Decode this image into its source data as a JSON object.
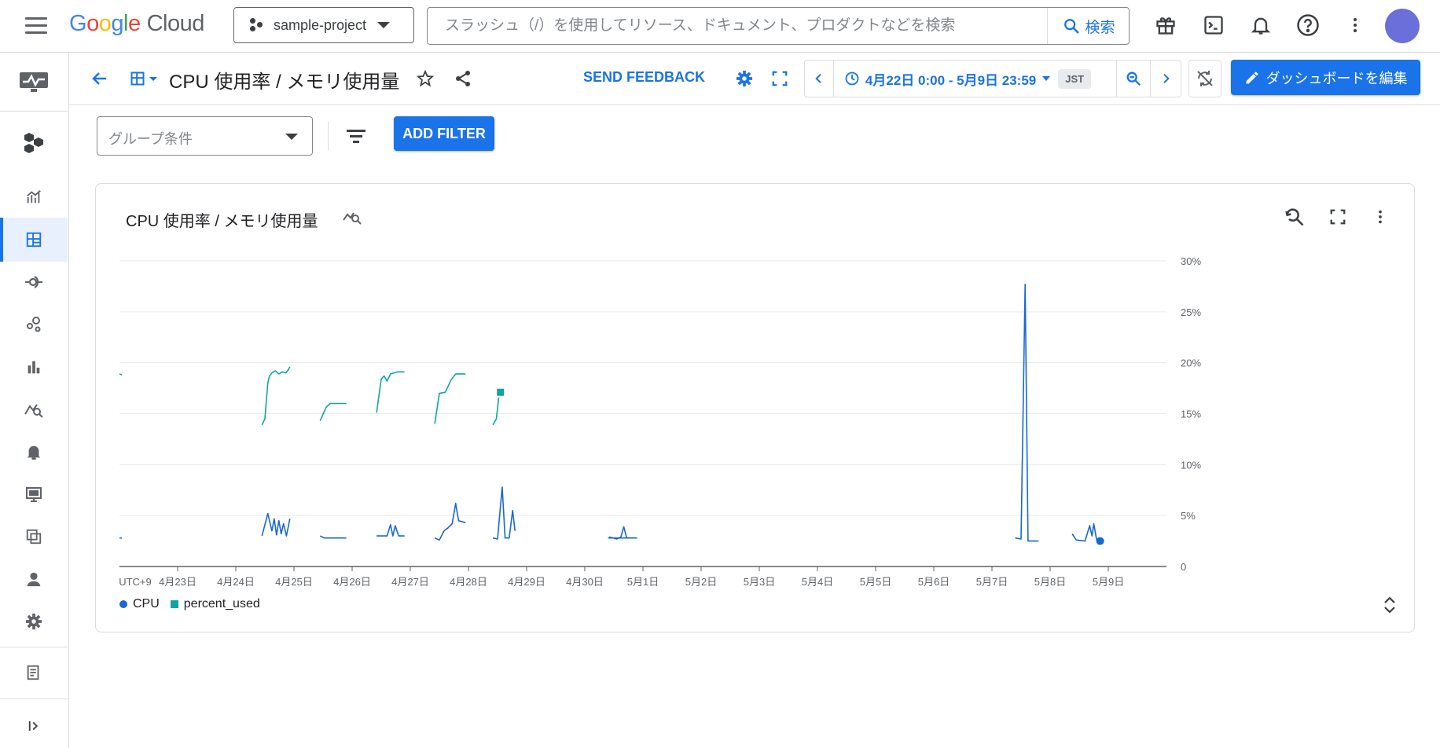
{
  "header": {
    "logo_google": "Google",
    "logo_cloud": "Cloud",
    "project": "sample-project",
    "search_placeholder": "スラッシュ（/）を使用してリソース、ドキュメント、プロダクトなどを検索",
    "search_button": "検索",
    "icons": [
      "gift-icon",
      "terminal-icon",
      "bell-icon",
      "help-icon",
      "more-vert-icon"
    ],
    "avatar_color": "#6b6fd9"
  },
  "sidebar": {
    "items": [
      "monitoring-logo-icon",
      "hexagons-icon",
      "metrics-explorer-icon",
      "dashboards-icon",
      "services-icon",
      "integrations-icon",
      "bar-chart-icon",
      "query-icon",
      "alerting-icon",
      "monitor-icon",
      "groups-icon",
      "person-icon",
      "settings-icon",
      "release-notes-icon",
      "collapse-icon"
    ],
    "active_item": "dashboards-icon"
  },
  "toolbar": {
    "title": "CPU 使用率 / メモリ使用量",
    "send_feedback": "SEND FEEDBACK",
    "time_range": "4月22日 0:00 - 5月9日 23:59",
    "timezone": "JST",
    "edit_dashboard": "ダッシュボードを編集"
  },
  "filters": {
    "group_placeholder": "グループ条件",
    "add_filter": "ADD FILTER"
  },
  "chart_card": {
    "title": "CPU 使用率 / メモリ使用量"
  },
  "colors": {
    "accent": "#1a73e8",
    "cpu_series": "#1967d2",
    "memory_series": "#12a4a0"
  },
  "chart_data": {
    "type": "line",
    "x_tick_labels": [
      "UTC+9",
      "4月23日",
      "4月24日",
      "4月25日",
      "4月26日",
      "4月27日",
      "4月28日",
      "4月29日",
      "4月30日",
      "5月1日",
      "5月2日",
      "5月3日",
      "5月4日",
      "5月5日",
      "5月6日",
      "5月7日",
      "5月8日",
      "5月9日"
    ],
    "y_tick_labels": [
      "30%",
      "25%",
      "20%",
      "15%",
      "10%",
      "5%",
      "0"
    ],
    "ylim": [
      0,
      30
    ],
    "xlim_days": [
      22.0,
      40.0
    ],
    "grid": true,
    "legend_position": "bottom-left",
    "series": [
      {
        "name": "CPU",
        "marker": "circle",
        "color": "#1967d2",
        "segments": [
          [
            [
              22.0,
              2.8
            ],
            [
              22.04,
              2.8
            ]
          ],
          [
            [
              24.45,
              3.0
            ],
            [
              24.55,
              5.2
            ],
            [
              24.62,
              3.5
            ],
            [
              24.66,
              4.7
            ],
            [
              24.7,
              3.1
            ],
            [
              24.74,
              4.5
            ],
            [
              24.78,
              3.2
            ],
            [
              24.82,
              4.2
            ],
            [
              24.87,
              3.0
            ],
            [
              24.93,
              4.7
            ]
          ],
          [
            [
              25.45,
              3.0
            ],
            [
              25.52,
              2.8
            ],
            [
              25.9,
              2.8
            ]
          ],
          [
            [
              26.42,
              3.0
            ],
            [
              26.6,
              3.0
            ],
            [
              26.66,
              4.1
            ],
            [
              26.7,
              3.0
            ],
            [
              26.74,
              4.0
            ],
            [
              26.8,
              3.0
            ],
            [
              26.9,
              3.0
            ]
          ],
          [
            [
              27.42,
              2.8
            ],
            [
              27.5,
              2.6
            ],
            [
              27.58,
              3.5
            ],
            [
              27.65,
              3.8
            ],
            [
              27.72,
              4.2
            ],
            [
              27.78,
              6.2
            ],
            [
              27.83,
              4.5
            ],
            [
              27.95,
              4.3
            ]
          ],
          [
            [
              28.42,
              2.8
            ],
            [
              28.5,
              2.7
            ],
            [
              28.58,
              7.8
            ],
            [
              28.63,
              2.8
            ],
            [
              28.7,
              2.8
            ],
            [
              28.76,
              5.5
            ],
            [
              28.8,
              3.5
            ]
          ],
          [
            [
              30.4,
              2.8
            ],
            [
              30.85,
              2.8
            ]
          ],
          [
            [
              30.42,
              2.9
            ],
            [
              30.55,
              2.7
            ],
            [
              30.62,
              2.9
            ],
            [
              30.67,
              3.9
            ],
            [
              30.72,
              2.8
            ],
            [
              30.9,
              2.8
            ]
          ],
          [
            [
              37.4,
              2.8
            ],
            [
              37.5,
              2.7
            ],
            [
              37.57,
              27.7
            ],
            [
              37.62,
              2.5
            ],
            [
              37.8,
              2.5
            ]
          ],
          [
            [
              38.38,
              3.2
            ],
            [
              38.45,
              2.6
            ],
            [
              38.6,
              2.5
            ],
            [
              38.68,
              4.0
            ],
            [
              38.72,
              3.0
            ],
            [
              38.75,
              4.2
            ],
            [
              38.8,
              2.6
            ],
            [
              38.86,
              2.5
            ]
          ]
        ],
        "last_point": [
          38.86,
          2.5
        ]
      },
      {
        "name": "percent_used",
        "marker": "square",
        "color": "#12a4a0",
        "segments": [
          [
            [
              22.0,
              18.9
            ],
            [
              22.04,
              18.8
            ]
          ],
          [
            [
              24.45,
              13.9
            ],
            [
              24.5,
              14.5
            ],
            [
              24.55,
              18.0
            ],
            [
              24.58,
              18.7
            ],
            [
              24.62,
              19.0
            ],
            [
              24.68,
              19.2
            ],
            [
              24.74,
              18.9
            ],
            [
              24.8,
              19.1
            ],
            [
              24.86,
              19.0
            ],
            [
              24.9,
              19.3
            ],
            [
              24.93,
              19.6
            ]
          ],
          [
            [
              25.45,
              14.3
            ],
            [
              25.55,
              15.6
            ],
            [
              25.62,
              16.0
            ],
            [
              25.9,
              16.0
            ]
          ],
          [
            [
              26.42,
              15.1
            ],
            [
              26.5,
              18.4
            ],
            [
              26.55,
              18.7
            ],
            [
              26.6,
              18.2
            ],
            [
              26.66,
              18.9
            ],
            [
              26.72,
              19.0
            ],
            [
              26.78,
              19.1
            ],
            [
              26.9,
              19.1
            ]
          ],
          [
            [
              27.42,
              14.0
            ],
            [
              27.5,
              17.0
            ],
            [
              27.6,
              17.1
            ],
            [
              27.7,
              18.3
            ],
            [
              27.78,
              18.9
            ],
            [
              27.95,
              18.9
            ]
          ],
          [
            [
              28.42,
              13.9
            ],
            [
              28.48,
              14.5
            ],
            [
              28.52,
              16.6
            ]
          ]
        ],
        "square_point": [
          28.55,
          17.1
        ]
      }
    ]
  }
}
